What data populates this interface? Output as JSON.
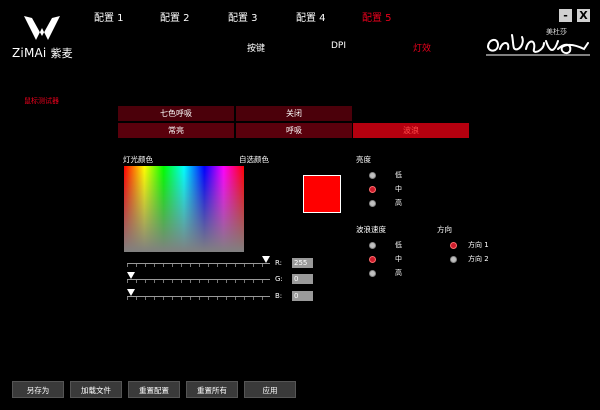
{
  "brand": {
    "latin": "ZiMAi",
    "chinese": "紫麦"
  },
  "profiles": [
    "配置 1",
    "配置 2",
    "配置 3",
    "配置 4",
    "配置 5"
  ],
  "active_profile": 4,
  "subtabs": [
    "按键",
    "DPI",
    "灯效"
  ],
  "active_subtab": 2,
  "window": {
    "minimize": "-",
    "close": "X"
  },
  "mouse_name": "美杜莎",
  "device_label": "鼠标测试器",
  "effects": {
    "row1": [
      "七色呼吸",
      "关闭"
    ],
    "row2": [
      "常亮",
      "呼吸",
      "波浪"
    ],
    "selected": "波浪"
  },
  "light_color_label": "灯光颜色",
  "custom_color_label": "自选颜色",
  "brightness": {
    "label": "亮度",
    "options": [
      "低",
      "中",
      "高"
    ],
    "selected": 1
  },
  "wave_speed": {
    "label": "波浪速度",
    "options": [
      "低",
      "中",
      "高"
    ],
    "selected": 1
  },
  "direction": {
    "label": "方向",
    "options": [
      "方向 1",
      "方向 2"
    ],
    "selected": 0
  },
  "rgb": [
    {
      "label": "R:",
      "value": "255",
      "fraction": 1.0
    },
    {
      "label": "G:",
      "value": "0",
      "fraction": 0.0
    },
    {
      "label": "B:",
      "value": "0",
      "fraction": 0.0
    }
  ],
  "selected_color": "#ff0000",
  "accent_color": "#e8001c",
  "buttons": [
    "另存为",
    "加载文件",
    "重置配置",
    "重置所有",
    "应用"
  ]
}
